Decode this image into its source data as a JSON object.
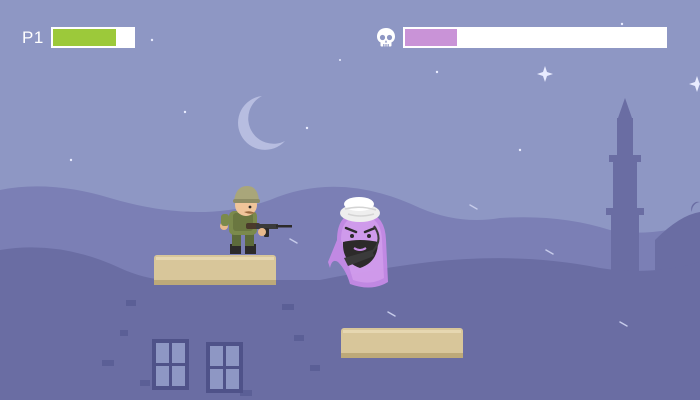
{
  "hud": {
    "player_label": "P1",
    "player_health": 0.79,
    "boss_icon": "skull-icon",
    "boss_health": 0.2
  },
  "colors": {
    "sky": "#8e97c4",
    "far_hills": "#7b7fb5",
    "ruins": "#6a6da3",
    "platform": "#d8c69a",
    "player_health": "#9cc93a",
    "boss_health": "#c993d7",
    "ghost": "#c58ae6"
  },
  "scene": {
    "moon_phase": "crescent",
    "player_character": "soldier-with-rifle",
    "enemy_character": "purple-ghost-with-turban"
  }
}
